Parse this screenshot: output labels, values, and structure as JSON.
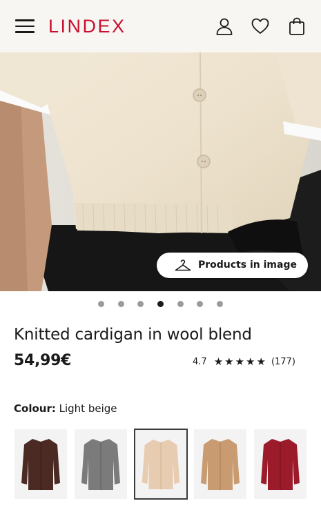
{
  "header": {
    "logo": "LINDEX",
    "brand_color": "#c8102e",
    "icons": [
      "menu-icon",
      "account-icon",
      "heart-icon",
      "bag-icon"
    ]
  },
  "hero": {
    "products_button_label": "Products in image",
    "pager": {
      "count": 7,
      "active_index": 3
    }
  },
  "product": {
    "title": "Knitted cardigan in wool blend",
    "price": "54,99€",
    "rating_value": "4.7",
    "stars": "★★★★★",
    "review_count": "(177)",
    "colour_label": "Colour:",
    "colour_value": "Light beige"
  },
  "swatches": [
    {
      "name": "Dark brown",
      "color": "#4a2a22",
      "selected": false
    },
    {
      "name": "Grey",
      "color": "#7b7b7b",
      "selected": false
    },
    {
      "name": "Light beige",
      "color": "#e7ccb1",
      "selected": true
    },
    {
      "name": "Camel",
      "color": "#c89b70",
      "selected": false
    },
    {
      "name": "Red",
      "color": "#9b1b2a",
      "selected": false
    }
  ]
}
